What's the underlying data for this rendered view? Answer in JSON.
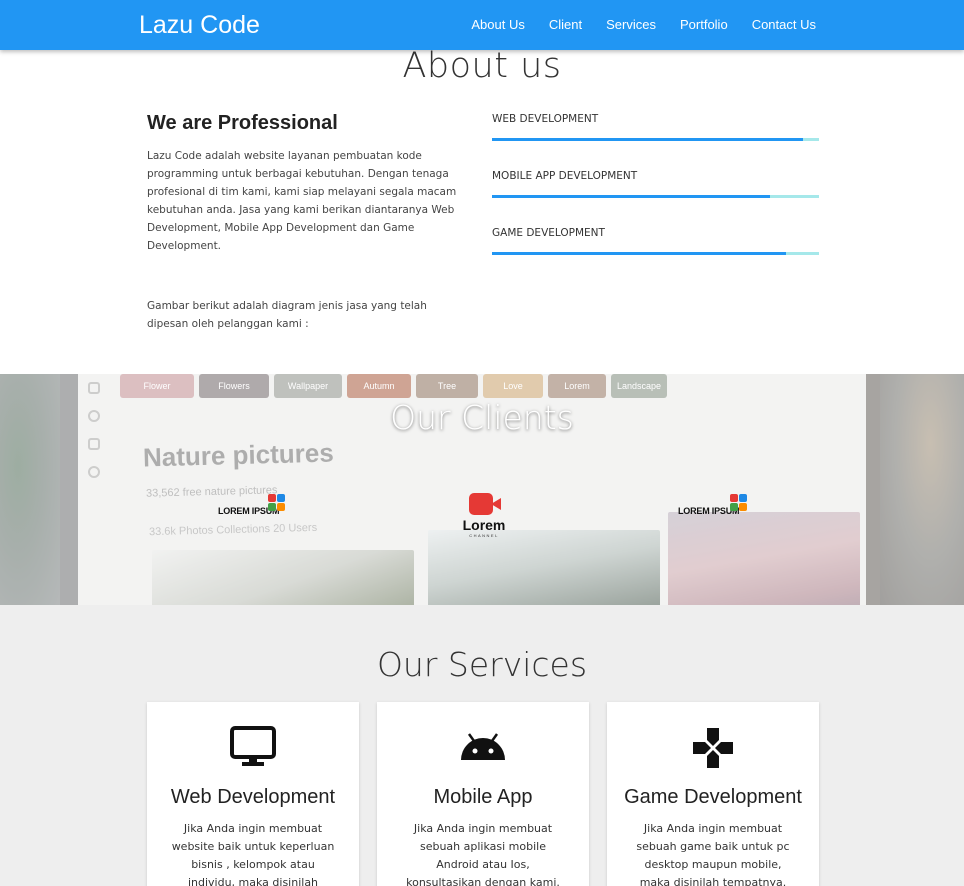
{
  "navbar": {
    "brand": "Lazu Code",
    "links": [
      "About Us",
      "Client",
      "Services",
      "Portfolio",
      "Contact Us"
    ],
    "color": "#2196f3"
  },
  "about": {
    "title": "About us",
    "subtitle": "We are Professional",
    "paragraph1": "Lazu Code adalah website layanan pembuatan kode programming untuk berbagai kebutuhan. Dengan tenaga profesional di tim kami, kami siap melayani segala macam kebutuhan anda. Jasa yang kami berikan diantaranya Web Development, Mobile App Development dan Game Development.",
    "paragraph2": "Gambar berikut adalah diagram jenis jasa yang telah dipesan oleh pelanggan kami :",
    "skills": [
      {
        "name": "WEB DEVELOPMENT",
        "level": 0.95
      },
      {
        "name": "MOBILE APP DEVELOPMENT",
        "level": 0.85
      },
      {
        "name": "GAME DEVELOPMENT",
        "level": 0.9
      }
    ],
    "bar_color": "#2196f3",
    "track_color": "#a5e8ea"
  },
  "clients": {
    "title": "Our Clients",
    "background": {
      "heading": "Nature pictures",
      "count": "33,562 free nature pictures",
      "tabs": "33.6k Photos    Collections    20 Users",
      "thumbs": [
        "Flower",
        "Flowers",
        "Wallpaper",
        "Autumn",
        "Tree",
        "Love",
        "Lorem",
        "Landscape"
      ]
    },
    "logos": [
      {
        "text": "LOREM IPSUM",
        "icon": "four-squares-icon"
      },
      {
        "text": "Lorem",
        "sub": "CHANNEL",
        "icon": "video-camera-icon"
      },
      {
        "text": "LOREM IPSUM",
        "icon": "four-squares-icon"
      }
    ]
  },
  "services": {
    "title": "Our Services",
    "cards": [
      {
        "icon": "monitor-icon",
        "title": "Web Development",
        "text": "Jika Anda ingin membuat website baik untuk keperluan bisnis , kelompok atau individu, maka disinilah tempatnya."
      },
      {
        "icon": "android-icon",
        "title": "Mobile App",
        "text": "Jika Anda ingin membuat sebuah aplikasi mobile Android atau Ios, konsultasikan dengan kami. Bersama tim profesional"
      },
      {
        "icon": "gamepad-icon",
        "title": "Game Development",
        "text": "Jika Anda ingin membuat sebuah game baik untuk pc desktop maupun mobile, maka disinilah tempatnya. Bersama"
      }
    ]
  }
}
